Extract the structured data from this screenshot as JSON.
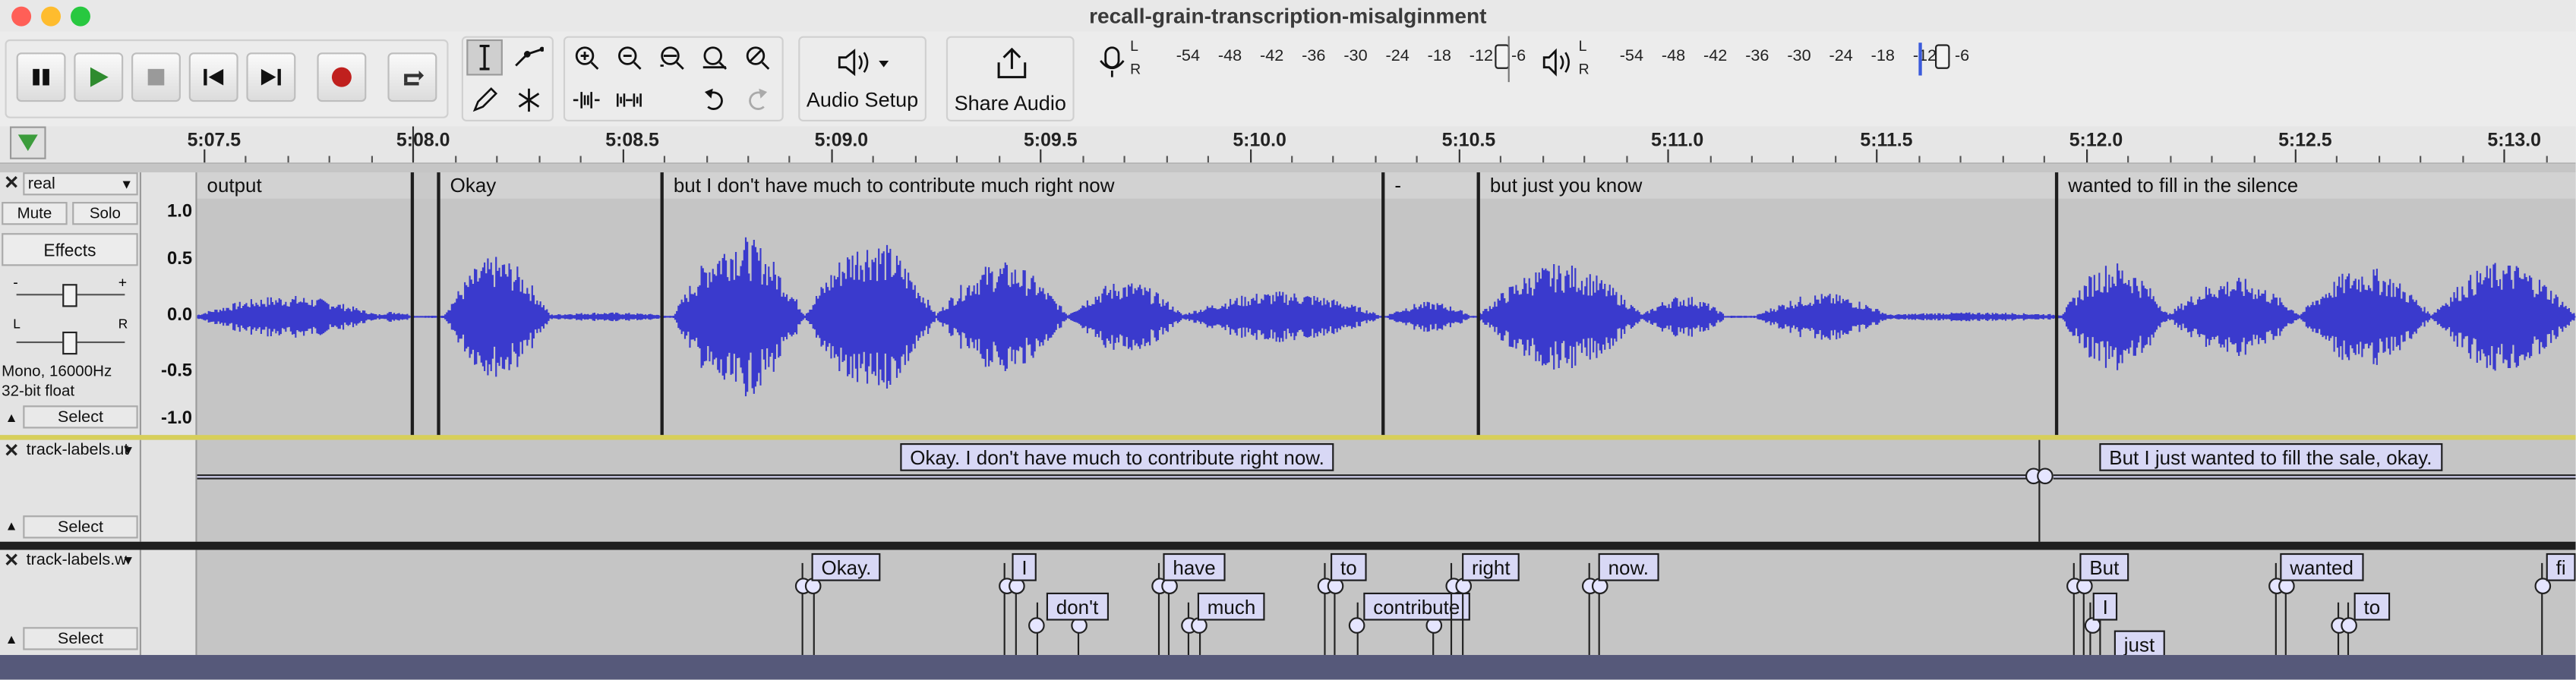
{
  "window": {
    "title": "recall-grain-transcription-misalginment",
    "close_color": "#ff5f57",
    "minimize_color": "#febc2e",
    "zoom_color": "#28c840"
  },
  "toolbar": {
    "transport": [
      "pause",
      "play",
      "stop",
      "skip-to-start",
      "skip-to-end",
      "record",
      "loop"
    ],
    "tools": [
      "selection-tool",
      "envelope-tool",
      "draw-tool",
      "multi-tool"
    ],
    "edit": [
      "zoom-in",
      "zoom-out",
      "fit-selection",
      "fit-project",
      "zoom-toggle",
      "trim-audio",
      "silence-audio",
      "undo",
      "redo"
    ],
    "audio_setup_label": "Audio Setup",
    "share_audio_label": "Share Audio",
    "record_meter_ticks": [
      "-54",
      "-48",
      "-42",
      "-36",
      "-30",
      "-24",
      "-18",
      "-12",
      "-6"
    ],
    "play_meter_ticks": [
      "-54",
      "-48",
      "-42",
      "-36",
      "-30",
      "-24",
      "-18",
      "-12",
      "-6"
    ],
    "meter_L": "L",
    "meter_R": "R"
  },
  "ruler": {
    "labels": [
      "5:07.5",
      "5:08.0",
      "5:08.5",
      "5:09.0",
      "5:09.5",
      "5:10.0",
      "5:10.5",
      "5:11.0",
      "5:11.5",
      "5:12.0",
      "5:12.5",
      "5:13.0"
    ],
    "playhead_color": "#3c9c3c"
  },
  "audio_track": {
    "name": "real",
    "mute_label": "Mute",
    "solo_label": "Solo",
    "effects_label": "Effects",
    "gain_minus": "-",
    "gain_plus": "+",
    "pan_left": "L",
    "pan_right": "R",
    "format_line1": "Mono, 16000Hz",
    "format_line2": "32-bit float",
    "select_label": "Select",
    "scale": [
      "1.0",
      "0.5",
      "0.0",
      "-0.5",
      "-1.0"
    ],
    "clips": [
      "output",
      "Okay",
      "but I don't have much to contribute much right now",
      "-",
      "but just you know",
      "wanted to fill in the silence"
    ],
    "waveform_color": "#3a3acd"
  },
  "utterance_track": {
    "name": "track-labels.ut",
    "select_label": "Select",
    "labels": [
      "Okay. I don't have much to contribute right now.",
      "But I just wanted to fill the sale, okay."
    ]
  },
  "word_track": {
    "name": "track-labels.w",
    "select_label": "Select",
    "labels": [
      "Okay.",
      "I",
      "don't",
      "have",
      "much",
      "to",
      "contribute",
      "right",
      "now.",
      "But",
      "I",
      "just",
      "wanted",
      "to",
      "fi"
    ]
  }
}
